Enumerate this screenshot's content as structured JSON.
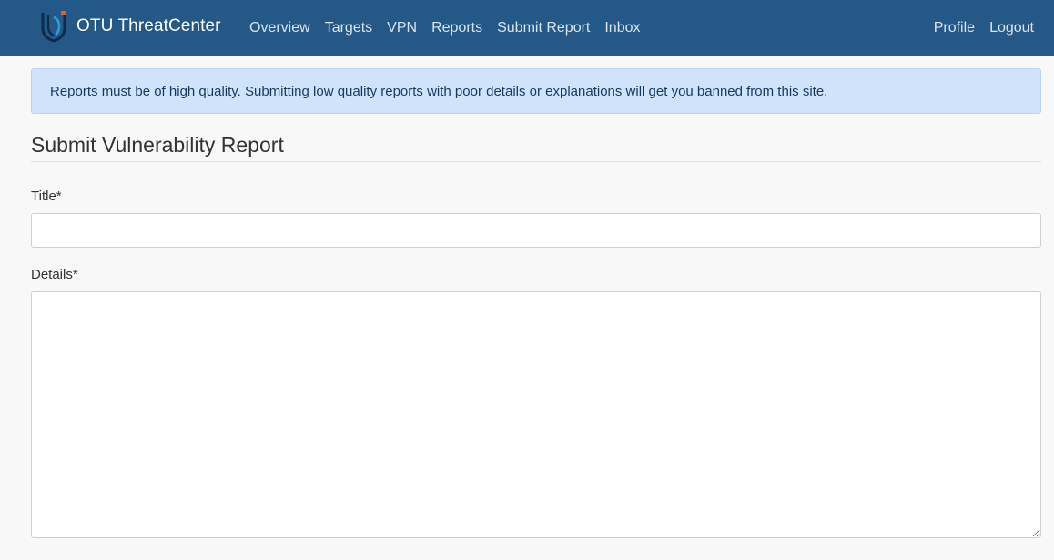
{
  "navbar": {
    "brand": "OTU ThreatCenter",
    "links": [
      "Overview",
      "Targets",
      "VPN",
      "Reports",
      "Submit Report",
      "Inbox"
    ],
    "right_links": [
      "Profile",
      "Logout"
    ],
    "background_color": "#235887",
    "logo_icon": "shield-logo-icon"
  },
  "alert": {
    "text": "Reports must be of high quality. Submitting low quality reports with poor details or explanations will get you banned from this site.",
    "background_color": "#cfe4fa"
  },
  "form": {
    "heading": "Submit Vulnerability Report",
    "title_label": "Title*",
    "title_value": "",
    "details_label": "Details*",
    "details_value": ""
  }
}
